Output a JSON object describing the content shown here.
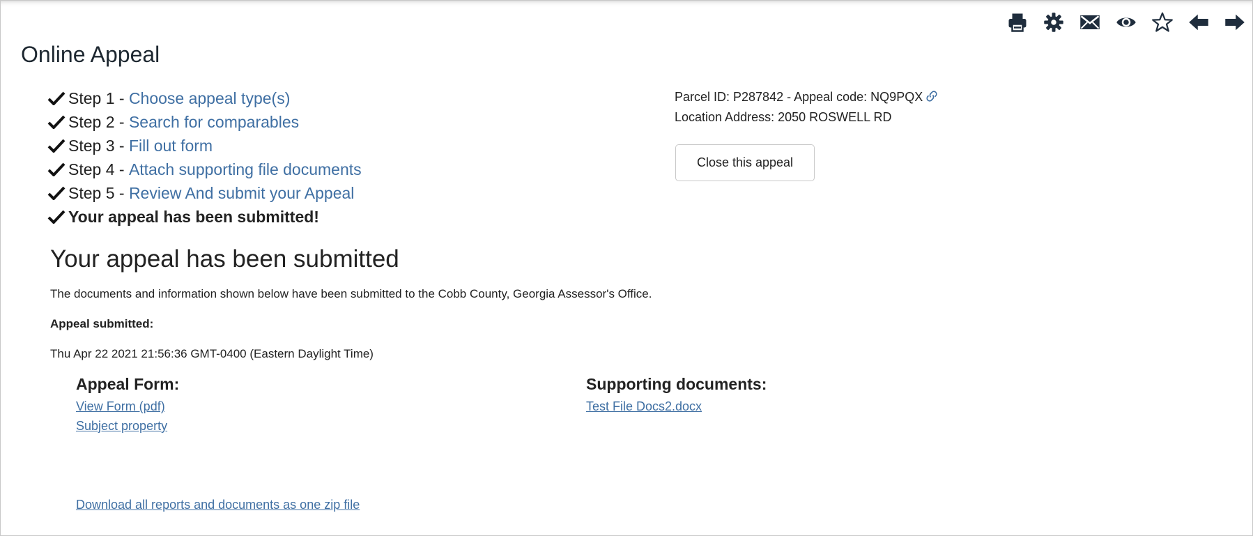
{
  "toolbar": {
    "icons": [
      "print-icon",
      "gear-icon",
      "mail-icon",
      "eye-icon",
      "star-icon",
      "arrow-left-icon",
      "arrow-right-icon"
    ],
    "color": "#1f2d3d"
  },
  "page": {
    "title": "Online Appeal"
  },
  "steps": [
    {
      "prefix": "Step 1 - ",
      "link": "Choose appeal type(s)"
    },
    {
      "prefix": "Step 2 - ",
      "link": "Search for comparables"
    },
    {
      "prefix": "Step 3 - ",
      "link": "Fill out form"
    },
    {
      "prefix": "Step 4 - ",
      "link": "Attach supporting file documents"
    },
    {
      "prefix": "Step 5 - ",
      "link": "Review And submit your Appeal"
    }
  ],
  "final_step": "Your appeal has been submitted!",
  "parcel": {
    "line1": "Parcel ID: P287842 - Appeal code: NQ9PQX",
    "line2": "Location Address: 2050 ROSWELL RD",
    "close_label": "Close this appeal"
  },
  "submitted": {
    "heading": "Your appeal has been submitted",
    "description": "The documents and information shown below have been submitted to the Cobb County, Georgia Assessor's Office.",
    "label": "Appeal submitted:",
    "date": "Thu Apr 22 2021 21:56:36 GMT-0400 (Eastern Daylight Time)"
  },
  "appeal_form": {
    "heading": "Appeal Form:",
    "links": [
      "View Form (pdf)",
      "Subject property"
    ]
  },
  "supporting": {
    "heading": "Supporting documents:",
    "links": [
      "Test File Docs2.docx"
    ]
  },
  "download_all": "Download all reports and documents as one zip file",
  "colors": {
    "link": "#3f6fa3",
    "text": "#222222",
    "icon": "#1f2d3d"
  }
}
